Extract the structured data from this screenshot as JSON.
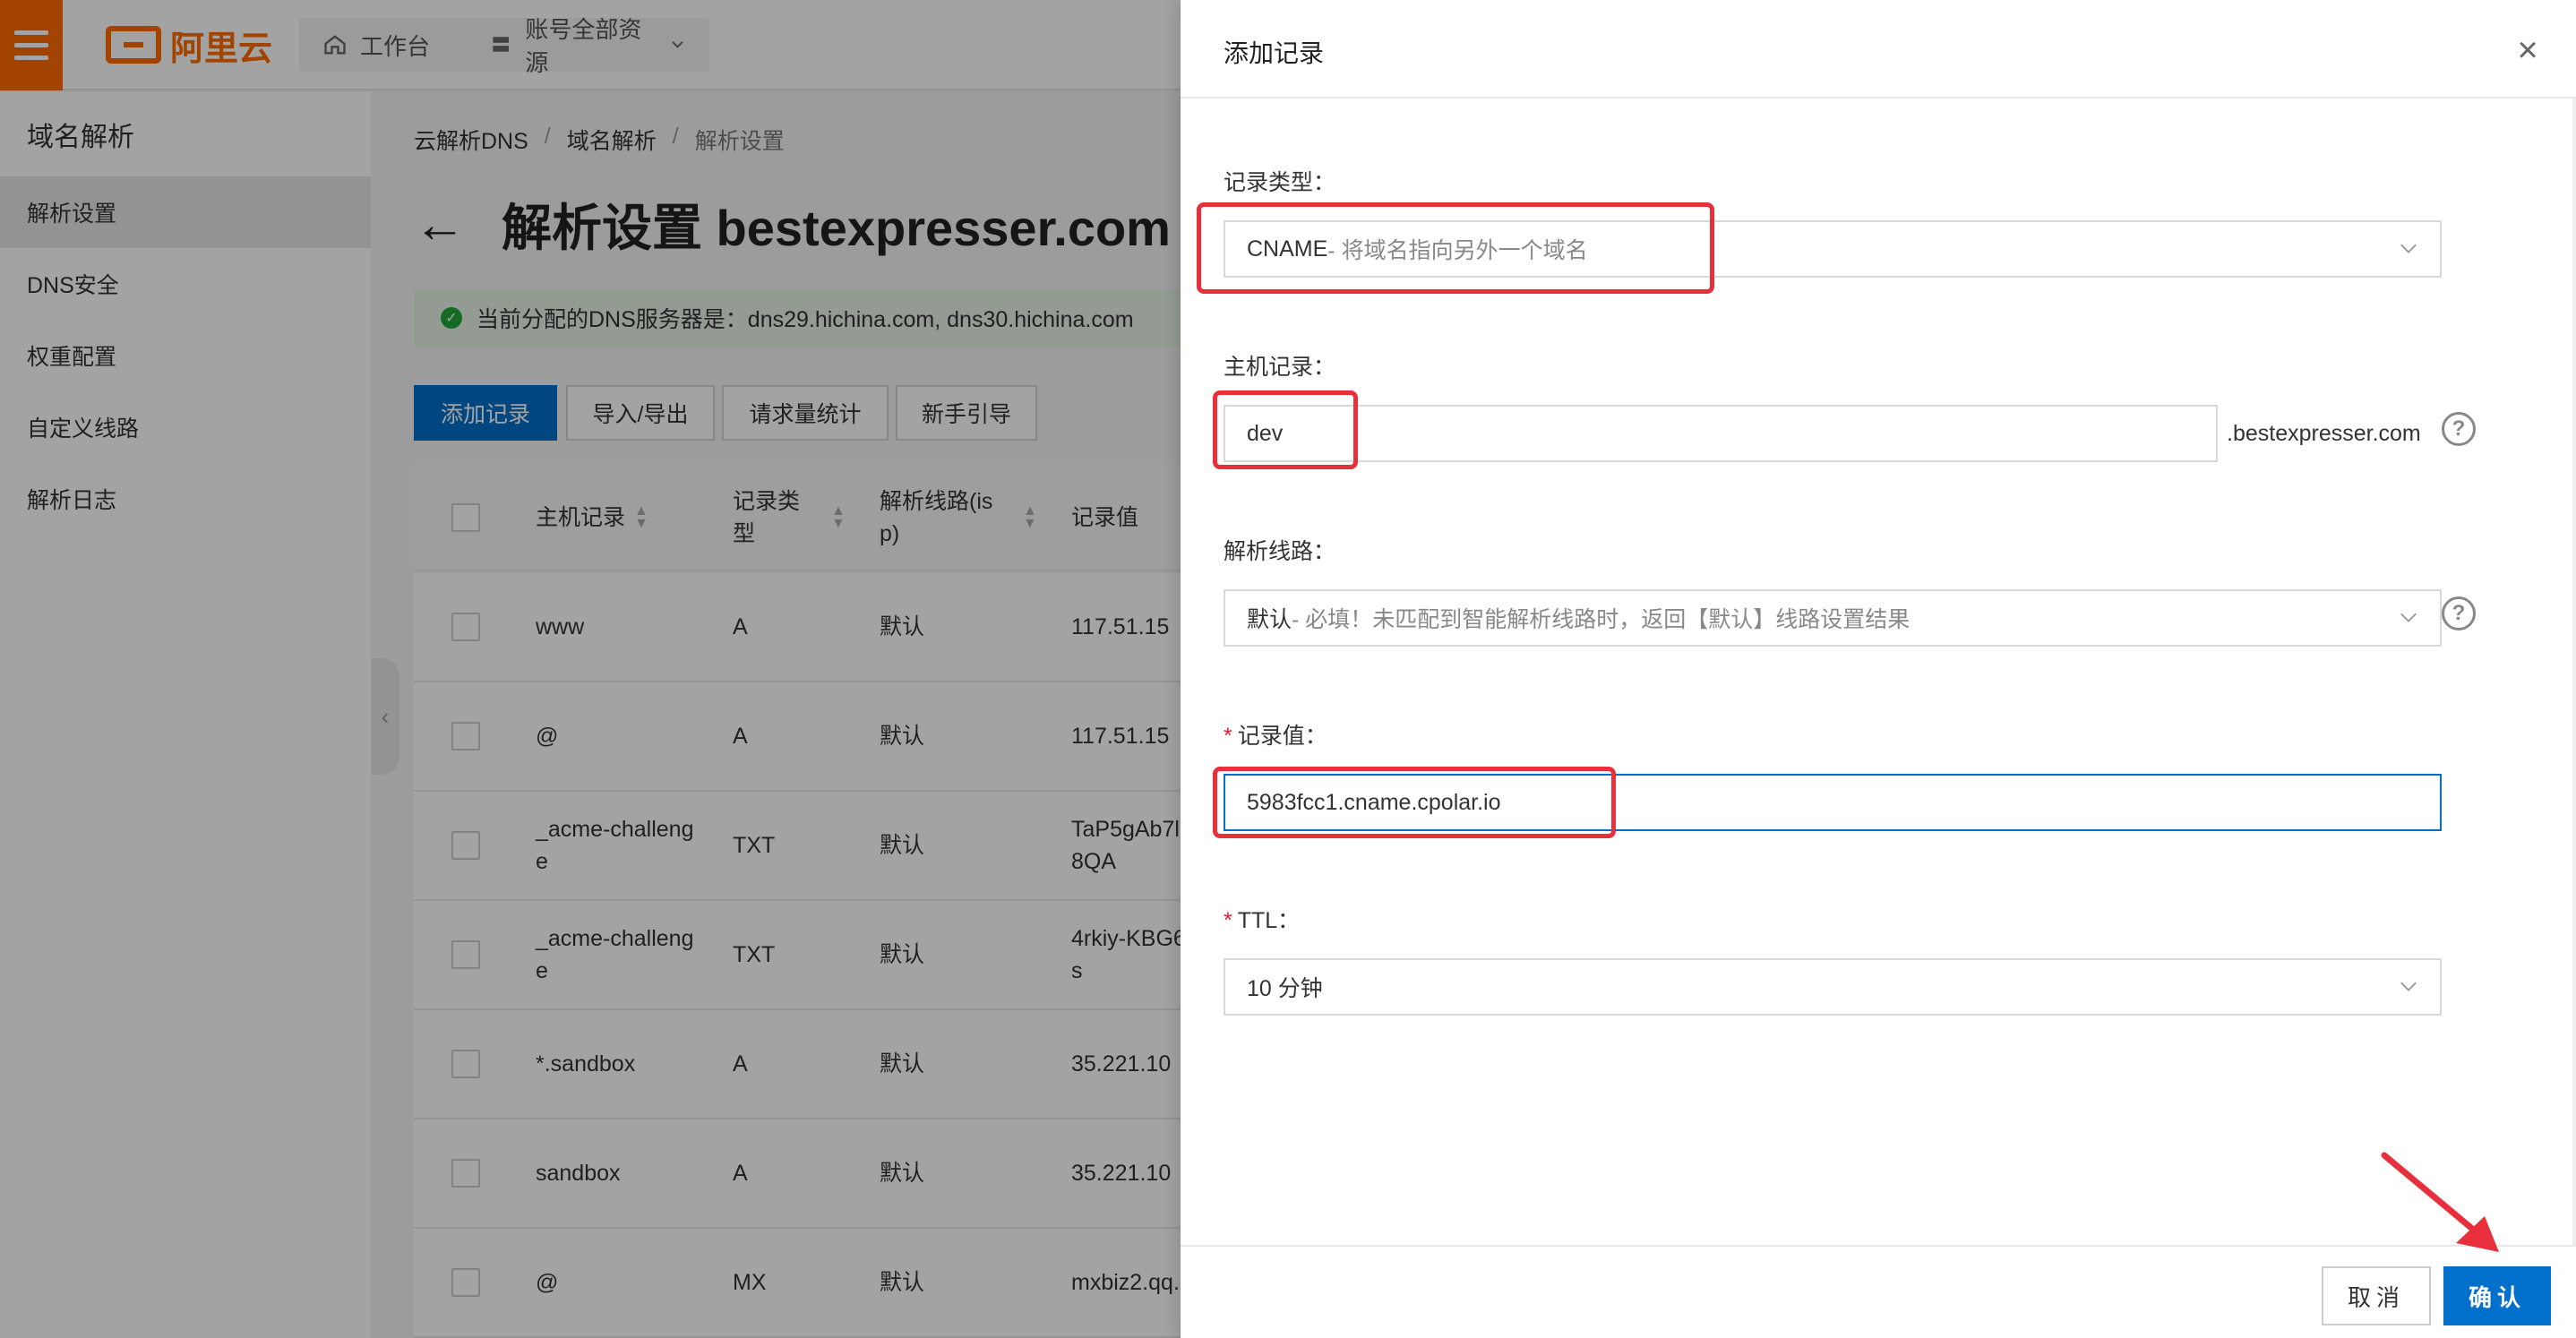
{
  "topbar": {
    "logo_text": "阿里云",
    "workbench_label": "工作台",
    "resources_label": "账号全部资源",
    "brand_color": "#ff6a00"
  },
  "sidebar": {
    "title": "域名解析",
    "items": [
      {
        "label": "解析设置",
        "active": true
      },
      {
        "label": "DNS安全"
      },
      {
        "label": "权重配置"
      },
      {
        "label": "自定义线路"
      },
      {
        "label": "解析日志"
      }
    ]
  },
  "breadcrumb": [
    "云解析DNS",
    "/",
    "域名解析",
    "/",
    "解析设置"
  ],
  "page": {
    "back_icon": "←",
    "title": "解析设置 bestexpresser.com",
    "dns_notice": "当前分配的DNS服务器是：dns29.hichina.com, dns30.hichina.com"
  },
  "actions": [
    "添加记录",
    "导入/导出",
    "请求量统计",
    "新手引导"
  ],
  "table": {
    "headers": {
      "host": "主机记录",
      "type_l1": "记录类",
      "type_l2": "型",
      "line_l1": "解析线路(is",
      "line_l2": "p)",
      "value": "记录值"
    },
    "rows": [
      {
        "host1": "www",
        "host2": "",
        "type": "A",
        "line": "默认",
        "val1": "117.51.15",
        "val2": ""
      },
      {
        "host1": "@",
        "host2": "",
        "type": "A",
        "line": "默认",
        "val1": "117.51.15",
        "val2": ""
      },
      {
        "host1": "_acme-challeng",
        "host2": "e",
        "type": "TXT",
        "line": "默认",
        "val1": "TaP5gAb7l",
        "val2": "8QA"
      },
      {
        "host1": "_acme-challeng",
        "host2": "e",
        "type": "TXT",
        "line": "默认",
        "val1": "4rkiy-KBG6",
        "val2": "s"
      },
      {
        "host1": "*.sandbox",
        "host2": "",
        "type": "A",
        "line": "默认",
        "val1": "35.221.10",
        "val2": ""
      },
      {
        "host1": "sandbox",
        "host2": "",
        "type": "A",
        "line": "默认",
        "val1": "35.221.10",
        "val2": ""
      },
      {
        "host1": "@",
        "host2": "",
        "type": "MX",
        "line": "默认",
        "val1": "mxbiz2.qq.",
        "val2": ""
      }
    ]
  },
  "drawer": {
    "title": "添加记录",
    "record_type": {
      "label": "记录类型：",
      "value": "CNAME",
      "hint": "- 将域名指向另外一个域名"
    },
    "host": {
      "label": "主机记录：",
      "value": "dev",
      "suffix": ".bestexpresser.com"
    },
    "line": {
      "label": "解析线路：",
      "value": "默认",
      "hint": " - 必填！未匹配到智能解析线路时，返回【默认】线路设置结果"
    },
    "record_value": {
      "required": "*",
      "label": "记录值：",
      "value": "5983fcc1.cname.cpolar.io"
    },
    "ttl": {
      "required": "*",
      "label": "TTL：",
      "value": "10 分钟"
    },
    "cancel_label": "取消",
    "ok_label": "确认",
    "accent_color": "#0070cc",
    "highlight_color": "#e8303c"
  }
}
